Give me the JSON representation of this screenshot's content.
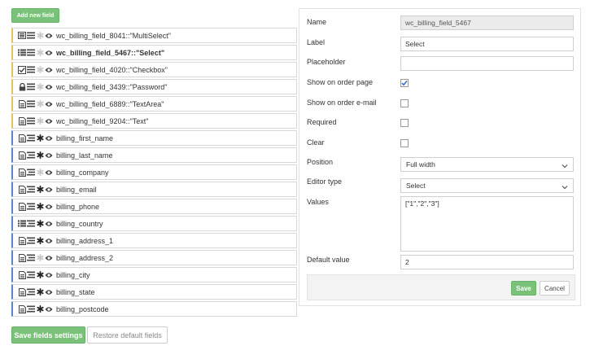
{
  "toolbar": {
    "add_label": "Add new field"
  },
  "fields": [
    {
      "name": "wc_billing_field_8041::\"MultiSelect\"",
      "type_icon": "multiselect-icon",
      "required": false,
      "kind": "custom"
    },
    {
      "name": "wc_billing_field_5467::\"Select\"",
      "type_icon": "list-icon",
      "required": false,
      "kind": "custom",
      "selected": true
    },
    {
      "name": "wc_billing_field_4020::\"Checkbox\"",
      "type_icon": "checkbox-icon",
      "required": false,
      "kind": "custom"
    },
    {
      "name": "wc_billing_field_3439::\"Password\"",
      "type_icon": "lock-icon",
      "required": false,
      "kind": "custom"
    },
    {
      "name": "wc_billing_field_6889::\"TextArea\"",
      "type_icon": "document-icon",
      "required": false,
      "kind": "custom"
    },
    {
      "name": "wc_billing_field_9204::\"Text\"",
      "type_icon": "document-icon",
      "required": false,
      "kind": "custom"
    },
    {
      "name": "billing_first_name",
      "type_icon": "document-icon",
      "required": true,
      "kind": "core"
    },
    {
      "name": "billing_last_name",
      "type_icon": "document-icon",
      "required": true,
      "kind": "core"
    },
    {
      "name": "billing_company",
      "type_icon": "document-icon",
      "required": false,
      "kind": "core"
    },
    {
      "name": "billing_email",
      "type_icon": "document-icon",
      "required": true,
      "kind": "core"
    },
    {
      "name": "billing_phone",
      "type_icon": "document-icon",
      "required": true,
      "kind": "core"
    },
    {
      "name": "billing_country",
      "type_icon": "list-icon",
      "required": true,
      "kind": "core"
    },
    {
      "name": "billing_address_1",
      "type_icon": "document-icon",
      "required": true,
      "kind": "core"
    },
    {
      "name": "billing_address_2",
      "type_icon": "document-icon",
      "required": false,
      "kind": "core"
    },
    {
      "name": "billing_city",
      "type_icon": "document-icon",
      "required": true,
      "kind": "core"
    },
    {
      "name": "billing_state",
      "type_icon": "document-icon",
      "required": true,
      "kind": "core"
    },
    {
      "name": "billing_postcode",
      "type_icon": "document-icon",
      "required": true,
      "kind": "core"
    }
  ],
  "footer": {
    "save_label": "Save fields settings",
    "restore_label": "Restore default fields"
  },
  "panel": {
    "name_label": "Name",
    "name_value": "wc_billing_field_5467",
    "label_label": "Label",
    "label_value": "Select",
    "placeholder_label": "Placeholder",
    "placeholder_value": "",
    "show_order_label": "Show on order page",
    "show_order_checked": true,
    "show_email_label": "Show on order e-mail",
    "show_email_checked": false,
    "required_label": "Required",
    "required_checked": false,
    "clear_label": "Clear",
    "clear_checked": false,
    "position_label": "Position",
    "position_value": "Full width",
    "editor_label": "Editor type",
    "editor_value": "Select",
    "values_label": "Values",
    "values_value": "[\"1\",\"2\",\"3\"]",
    "default_label": "Default value",
    "default_value": "2",
    "save_label": "Save",
    "cancel_label": "Cancel"
  },
  "colors": {
    "accent_green": "#7ac27a",
    "custom_border": "#e1c45f",
    "core_border": "#5b87c8"
  }
}
